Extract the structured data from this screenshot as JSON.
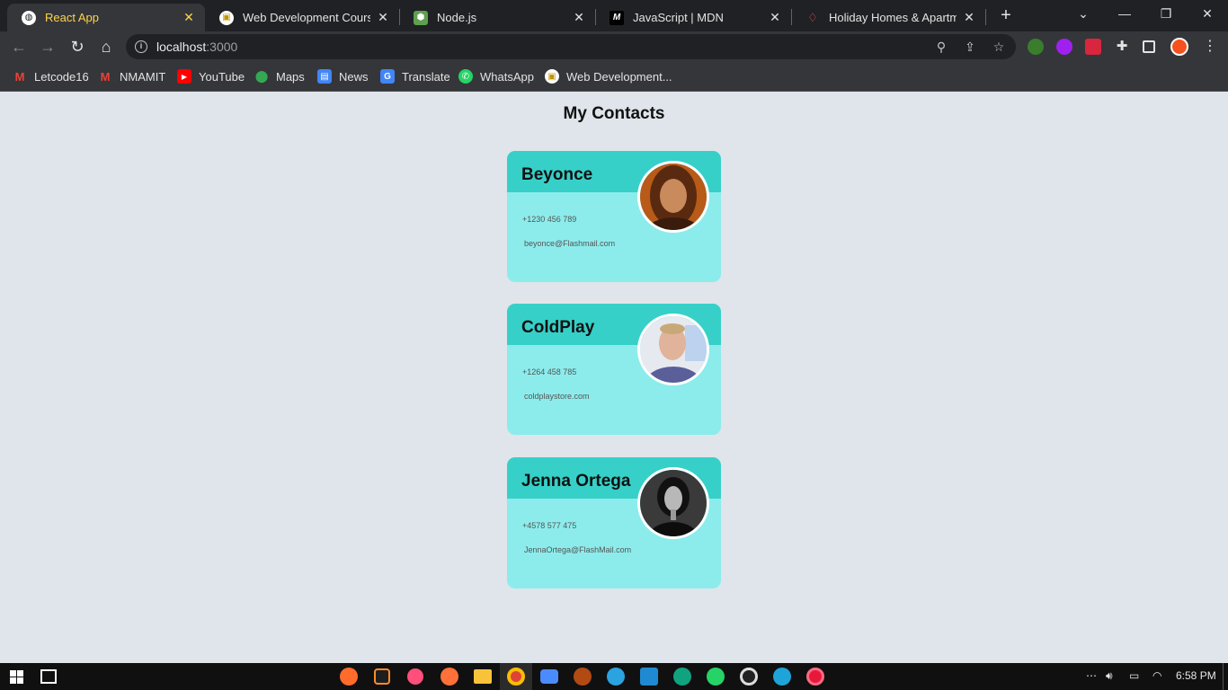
{
  "browser": {
    "tabs": [
      {
        "title": "React App",
        "active": true
      },
      {
        "title": "Web Development Course Re",
        "active": false
      },
      {
        "title": "Node.js",
        "active": false
      },
      {
        "title": "JavaScript | MDN",
        "active": false
      },
      {
        "title": "Holiday Homes & Apartment",
        "active": false
      }
    ],
    "url_host": "localhost",
    "url_port": ":3000",
    "bookmarks": [
      {
        "label": "Letcode16",
        "icon": "gmail-icon"
      },
      {
        "label": "NMAMIT",
        "icon": "gmail-icon"
      },
      {
        "label": "YouTube",
        "icon": "youtube-icon"
      },
      {
        "label": "Maps",
        "icon": "maps-icon"
      },
      {
        "label": "News",
        "icon": "news-icon"
      },
      {
        "label": "Translate",
        "icon": "translate-icon"
      },
      {
        "label": "WhatsApp",
        "icon": "whatsapp-icon"
      },
      {
        "label": "Web Development...",
        "icon": "web-dev-icon"
      }
    ]
  },
  "page": {
    "heading": "My Contacts",
    "contacts": [
      {
        "name": "Beyonce",
        "phone": "+1230 456 789",
        "email": "beyonce@Flashmail.com"
      },
      {
        "name": "ColdPlay",
        "phone": "+1264 458 785",
        "email": "coldplaystore.com"
      },
      {
        "name": "Jenna Ortega",
        "phone": "+4578 577 475",
        "email": "JennaOrtega@FlashMail.com"
      }
    ]
  },
  "taskbar": {
    "time": "6:58 PM"
  },
  "colors": {
    "card_header": "#36d0c8",
    "card_body": "#8cecec",
    "page_bg": "#dfe5ea",
    "active_tab_text": "#ffd54a"
  }
}
